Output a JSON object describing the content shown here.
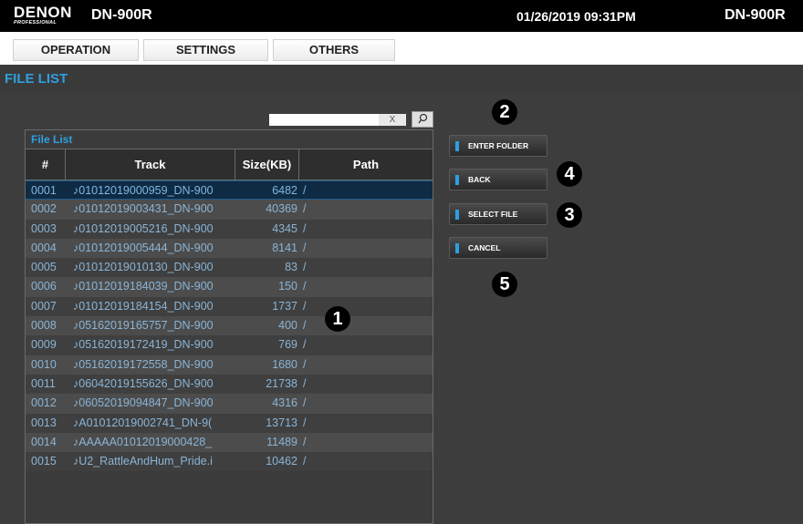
{
  "topbar": {
    "logo": "DENON",
    "logo_sub": "PROFESSIONAL",
    "model_left": "DN-900R",
    "datetime": "01/26/2019 09:31PM",
    "model_right": "DN-900R"
  },
  "tabs": [
    {
      "label": "OPERATION"
    },
    {
      "label": "SETTINGS"
    },
    {
      "label": "OTHERS"
    }
  ],
  "section_title": "FILE LIST",
  "search": {
    "value": "",
    "clear_label": "X",
    "button_icon": "search-icon"
  },
  "list": {
    "title": "File List",
    "columns": [
      "#",
      "Track",
      "Size(KB)",
      "Path"
    ],
    "rows": [
      {
        "num": "0001",
        "track": "♪01012019000959_DN-900",
        "size": "6482",
        "path": "/",
        "selected": true
      },
      {
        "num": "0002",
        "track": "♪01012019003431_DN-900",
        "size": "40369",
        "path": "/"
      },
      {
        "num": "0003",
        "track": "♪01012019005216_DN-900",
        "size": "4345",
        "path": "/"
      },
      {
        "num": "0004",
        "track": "♪01012019005444_DN-900",
        "size": "8141",
        "path": "/"
      },
      {
        "num": "0005",
        "track": "♪01012019010130_DN-900",
        "size": "83",
        "path": "/"
      },
      {
        "num": "0006",
        "track": "♪01012019184039_DN-900",
        "size": "150",
        "path": "/"
      },
      {
        "num": "0007",
        "track": "♪01012019184154_DN-900",
        "size": "1737",
        "path": "/"
      },
      {
        "num": "0008",
        "track": "♪05162019165757_DN-900",
        "size": "400",
        "path": "/"
      },
      {
        "num": "0009",
        "track": "♪05162019172419_DN-900",
        "size": "769",
        "path": "/"
      },
      {
        "num": "0010",
        "track": "♪05162019172558_DN-900",
        "size": "1680",
        "path": "/"
      },
      {
        "num": "0011",
        "track": "♪06042019155626_DN-900",
        "size": "21738",
        "path": "/"
      },
      {
        "num": "0012",
        "track": "♪06052019094847_DN-900",
        "size": "4316",
        "path": "/"
      },
      {
        "num": "0013",
        "track": "♪A01012019002741_DN-9(",
        "size": "13713",
        "path": "/"
      },
      {
        "num": "0014",
        "track": "♪AAAAA01012019000428_",
        "size": "11489",
        "path": "/"
      },
      {
        "num": "0015",
        "track": "♪U2_RattleAndHum_Pride.i",
        "size": "10462",
        "path": "/"
      }
    ]
  },
  "buttons": {
    "enter_folder": "ENTER FOLDER",
    "back": "BACK",
    "select_file": "SELECT FILE",
    "cancel": "CANCEL"
  },
  "callouts": [
    "1",
    "2",
    "3",
    "4",
    "5"
  ],
  "colors": {
    "accent": "#2e9fe0",
    "row_text": "#8ab4d6",
    "selected_row": "#0f2b44"
  }
}
